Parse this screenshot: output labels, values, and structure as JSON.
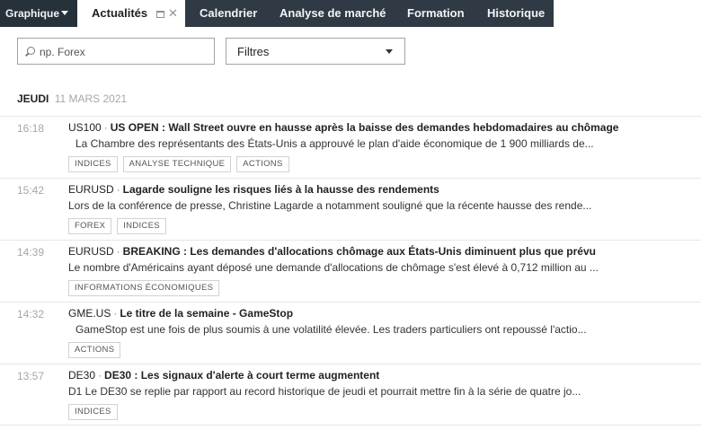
{
  "topbar": {
    "graph_label": "Graphique",
    "active_tab": "Actualités",
    "tabs": [
      "Calendrier",
      "Analyse de marché",
      "Formation",
      "Historique"
    ]
  },
  "search": {
    "placeholder": "np. Forex",
    "value": ""
  },
  "filters": {
    "label": "Filtres"
  },
  "date_header": {
    "day": "JEUDI",
    "date": "11 MARS 2021"
  },
  "news": [
    {
      "time": "16:18",
      "symbol": "US100",
      "title": "US OPEN : Wall Street ouvre en hausse après la baisse des demandes hebdomadaires au chômage",
      "summary": "La Chambre des représentants des États-Unis a approuvé le plan d'aide économique de 1 900 milliards de...",
      "tags": [
        "INDICES",
        "ANALYSE TECHNIQUE",
        "ACTIONS"
      ]
    },
    {
      "time": "15:42",
      "symbol": "EURUSD",
      "title": "Lagarde souligne les risques liés à la hausse des rendements",
      "summary": "Lors de la conférence de presse, Christine Lagarde a notamment souligné que la récente hausse des rende...",
      "tags": [
        "FOREX",
        "INDICES"
      ]
    },
    {
      "time": "14:39",
      "symbol": "EURUSD",
      "title": "BREAKING : Les demandes d'allocations chômage aux États-Unis diminuent plus que prévu",
      "summary": "Le nombre d'Américains ayant déposé une demande d'allocations de chômage s'est élevé à 0,712 million au ...",
      "tags": [
        "INFORMATIONS ÉCONOMIQUES"
      ]
    },
    {
      "time": "14:32",
      "symbol": "GME.US",
      "title": "Le titre de la semaine - GameStop",
      "summary": "GameStop est une fois de plus soumis à une volatilité élevée. Les traders particuliers ont repoussé l'actio...",
      "tags": [
        "ACTIONS"
      ]
    },
    {
      "time": "13:57",
      "symbol": "DE30",
      "title": "DE30 : Les signaux d'alerte à court terme augmentent",
      "summary": "D1 Le DE30 se replie par rapport au record historique de jeudi et pourrait mettre fin à la série de quatre jo...",
      "tags": [
        "INDICES"
      ]
    }
  ]
}
